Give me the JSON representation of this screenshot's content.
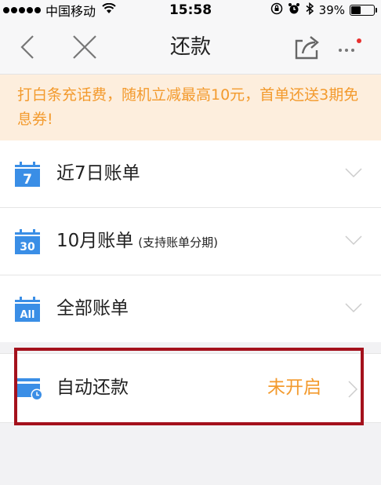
{
  "status_bar": {
    "carrier": "中国移动",
    "time": "15:58",
    "battery": "39%",
    "battery_level": 0.39
  },
  "navbar": {
    "title": "还款"
  },
  "promo": {
    "text": "打白条充话费，随机立减最高10元，首单还送3期免息券!"
  },
  "bills": [
    {
      "label": "近7日账单",
      "sub": "",
      "icon_text": "7"
    },
    {
      "label": "10月账单",
      "sub": "(支持账单分期)",
      "icon_text": "30"
    },
    {
      "label": "全部账单",
      "sub": "",
      "icon_text": "All"
    }
  ],
  "auto_repay": {
    "label": "自动还款",
    "status": "未开启"
  },
  "colors": {
    "accent_orange": "#f39a2d",
    "icon_blue": "#3a8ee6",
    "promo_bg": "#fdeedd",
    "highlight_red": "#a4111c",
    "notification_dot": "#e8312f"
  },
  "icons": [
    "wifi-icon",
    "alarm-icon",
    "bluetooth-icon",
    "battery-icon",
    "back-icon",
    "close-icon",
    "share-icon",
    "more-icon",
    "calendar-icon",
    "chevron-down-icon",
    "chevron-right-icon"
  ]
}
